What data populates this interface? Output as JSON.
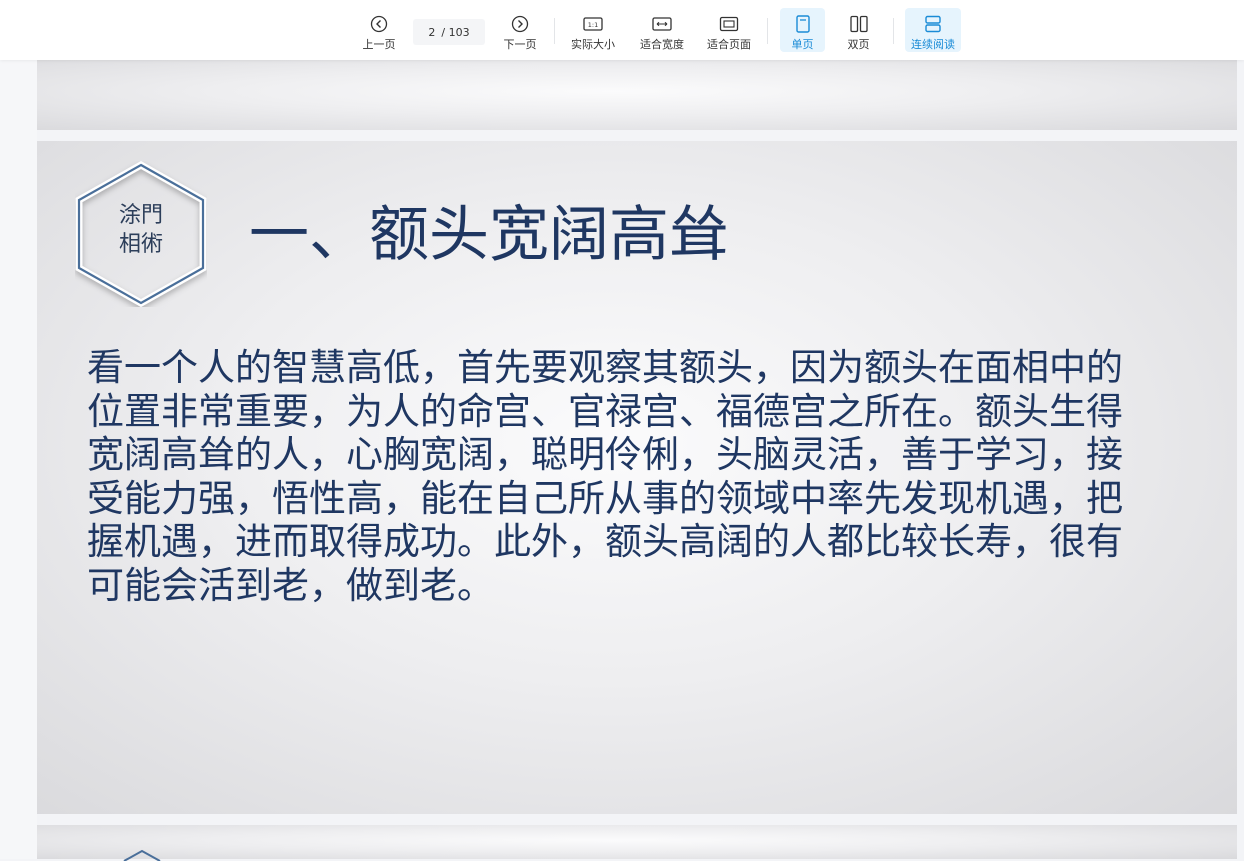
{
  "toolbar": {
    "prev_label": "上一页",
    "next_label": "下一页",
    "page_current": "2",
    "page_total": "/ 103",
    "actual_size_label": "实际大小",
    "actual_size_glyph": "1:1",
    "fit_width_label": "适合宽度",
    "fit_page_label": "适合页面",
    "single_page_label": "单页",
    "double_page_label": "双页",
    "continuous_label": "连续阅读",
    "accent_color": "#1a8bd6",
    "active_bg": "#e6f4fd"
  },
  "slide": {
    "logo_line1": "涂門",
    "logo_line2": "相術",
    "title": "一、额头宽阔高耸",
    "body_lines": [
      "看一个人的智慧高低，首先要观察其额头，因为额头在面相中的",
      "位置非常重要，为人的命宫、官禄宫、福德宫之所在。额头生得",
      "宽阔高耸的人，心胸宽阔，聪明伶俐，头脑灵活，善于学习，接",
      "受能力强，悟性高，能在自己所从事的领域中率先发现机遇，把",
      "握机遇，进而取得成功。此外，额头高阔的人都比较长寿，很有",
      "可能会活到老，做到老。"
    ],
    "text_color": "#1f3762",
    "hex_color": "#4a6f9a"
  }
}
